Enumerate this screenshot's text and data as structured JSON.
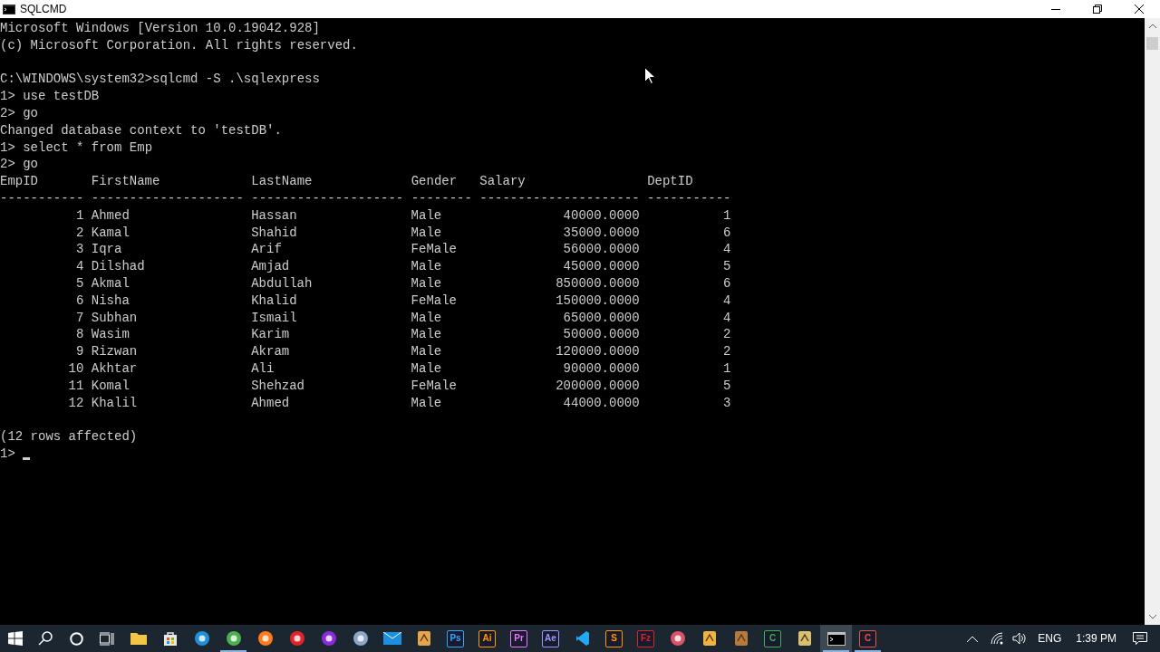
{
  "window": {
    "title": "SQLCMD"
  },
  "console": {
    "lines_before": [
      {
        "kind": "text",
        "text": "Microsoft Windows [Version 10.0.19042.928]"
      },
      {
        "kind": "text",
        "text": "(c) Microsoft Corporation. All rights reserved."
      },
      {
        "kind": "blank"
      },
      {
        "kind": "text",
        "text": "C:\\WINDOWS\\system32>sqlcmd -S .\\sqlexpress"
      },
      {
        "kind": "text",
        "text": "1> use testDB"
      },
      {
        "kind": "text",
        "text": "2> go"
      },
      {
        "kind": "text",
        "text": "Changed database context to 'testDB'."
      },
      {
        "kind": "text",
        "text": "1> select * from Emp"
      },
      {
        "kind": "text",
        "text": "2> go"
      }
    ],
    "table": {
      "columns": [
        {
          "name": "EmpID",
          "rule": "-----------"
        },
        {
          "name": "FirstName",
          "rule": "--------------------"
        },
        {
          "name": "LastName",
          "rule": "--------------------"
        },
        {
          "name": "Gender",
          "rule": "--------"
        },
        {
          "name": "Salary",
          "rule": "---------------------"
        },
        {
          "name": "DeptID",
          "rule": "-----------"
        }
      ],
      "rows": [
        [
          "1",
          "Ahmed",
          "Hassan",
          "Male",
          "40000.0000",
          "1"
        ],
        [
          "2",
          "Kamal",
          "Shahid",
          "Male",
          "35000.0000",
          "6"
        ],
        [
          "3",
          "Iqra",
          "Arif",
          "FeMale",
          "56000.0000",
          "4"
        ],
        [
          "4",
          "Dilshad",
          "Amjad",
          "Male",
          "45000.0000",
          "5"
        ],
        [
          "5",
          "Akmal",
          "Abdullah",
          "Male",
          "850000.0000",
          "6"
        ],
        [
          "6",
          "Nisha",
          "Khalid",
          "FeMale",
          "150000.0000",
          "4"
        ],
        [
          "7",
          "Subhan",
          "Ismail",
          "Male",
          "65000.0000",
          "4"
        ],
        [
          "8",
          "Wasim",
          "Karim",
          "Male",
          "50000.0000",
          "2"
        ],
        [
          "9",
          "Rizwan",
          "Akram",
          "Male",
          "120000.0000",
          "2"
        ],
        [
          "10",
          "Akhtar",
          "Ali",
          "Male",
          "90000.0000",
          "1"
        ],
        [
          "11",
          "Komal",
          "Shehzad",
          "FeMale",
          "200000.0000",
          "5"
        ],
        [
          "12",
          "Khalil",
          "Ahmed",
          "Male",
          "44000.0000",
          "3"
        ]
      ]
    },
    "lines_after": [
      {
        "kind": "blank"
      },
      {
        "kind": "text",
        "text": "(12 rows affected)"
      }
    ],
    "prompt": "1>",
    "cursor": true
  },
  "taskbar": {
    "apps": [
      {
        "kind": "folder",
        "color": "#f4c542",
        "running": false,
        "selected": false
      },
      {
        "kind": "bag",
        "color": "#e8e8e8",
        "running": false,
        "selected": false
      },
      {
        "kind": "ring",
        "color": "#1e8fd8",
        "running": false,
        "selected": false
      },
      {
        "kind": "ring",
        "color": "#4caf50",
        "running": true,
        "selected": false
      },
      {
        "kind": "ring",
        "color": "#ff7a1a",
        "running": false,
        "selected": false
      },
      {
        "kind": "ring",
        "color": "#e0262b",
        "running": false,
        "selected": false
      },
      {
        "kind": "ring",
        "color": "#8a2be2",
        "running": false,
        "selected": false
      },
      {
        "kind": "ring",
        "color": "#8aa6c8",
        "running": false,
        "selected": false
      },
      {
        "kind": "mail",
        "color": "#1d8fe1",
        "running": false,
        "selected": false
      },
      {
        "kind": "doc",
        "color": "#e8a64a",
        "running": false,
        "selected": false
      },
      {
        "kind": "tile",
        "color": "#31a8ff",
        "label": "Ps",
        "running": false,
        "selected": false
      },
      {
        "kind": "tile",
        "color": "#ff9a00",
        "label": "Ai",
        "running": false,
        "selected": false
      },
      {
        "kind": "tile",
        "color": "#ea77ff",
        "label": "Pr",
        "running": false,
        "selected": false
      },
      {
        "kind": "tile",
        "color": "#9999ff",
        "label": "Ae",
        "running": false,
        "selected": false
      },
      {
        "kind": "ribbon",
        "color": "#23a9f2",
        "running": false,
        "selected": false
      },
      {
        "kind": "tile",
        "color": "#ff9800",
        "label": "S",
        "running": false,
        "selected": false
      },
      {
        "kind": "tile",
        "color": "#d42a27",
        "label": "Fz",
        "running": false,
        "selected": false
      },
      {
        "kind": "ring",
        "color": "#d9546a",
        "running": false,
        "selected": false
      },
      {
        "kind": "doc",
        "color": "#f0b441",
        "running": false,
        "selected": false
      },
      {
        "kind": "doc",
        "color": "#b57a3c",
        "running": false,
        "selected": false
      },
      {
        "kind": "tile",
        "color": "#3ab54a",
        "label": "C",
        "running": false,
        "selected": false
      },
      {
        "kind": "doc",
        "color": "#d8c070",
        "running": false,
        "selected": false
      },
      {
        "kind": "console",
        "color": "#c0c0c0",
        "running": true,
        "selected": true
      },
      {
        "kind": "tile",
        "color": "#e8553d",
        "label": "C",
        "running": true,
        "selected": false
      }
    ],
    "language": "ENG",
    "time": "1:39 PM"
  }
}
